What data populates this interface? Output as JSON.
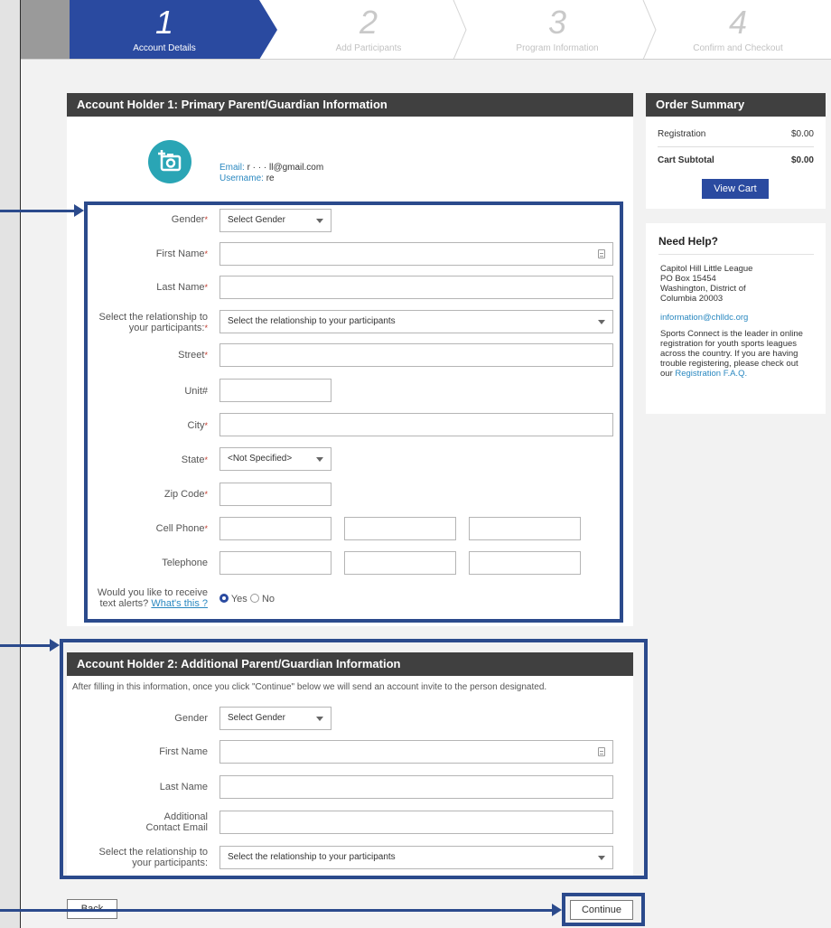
{
  "steps": [
    {
      "num": "1",
      "label": "Account Details"
    },
    {
      "num": "2",
      "label": "Add Participants"
    },
    {
      "num": "3",
      "label": "Program Information"
    },
    {
      "num": "4",
      "label": "Confirm and Checkout"
    }
  ],
  "holder1": {
    "title": "Account Holder 1: Primary Parent/Guardian Information",
    "email_label": "Email:",
    "email_value": "r       ·      ·  ·  ll@gmail.com",
    "username_label": "Username:",
    "username_value": "re",
    "fields": {
      "gender": {
        "label": "Gender",
        "value": "Select Gender"
      },
      "first_name": {
        "label": "First Name"
      },
      "last_name": {
        "label": "Last Name"
      },
      "relationship": {
        "label_line1": "Select the relationship to",
        "label_line2": "your participants:",
        "value": "Select the relationship to your participants"
      },
      "street": {
        "label": "Street"
      },
      "unit": {
        "label": "Unit#"
      },
      "city": {
        "label": "City"
      },
      "state": {
        "label": "State",
        "value": "<Not Specified>"
      },
      "zip": {
        "label": "Zip Code"
      },
      "cell": {
        "label": "Cell Phone"
      },
      "telephone": {
        "label": "Telephone"
      }
    },
    "text_alerts": {
      "label_line1": "Would you like to receive",
      "label_line2": "text alerts?",
      "link": "What's this ?",
      "yes": "Yes",
      "no": "No",
      "selected": "Yes"
    },
    "required_mark": "*"
  },
  "holder2": {
    "title": "Account Holder 2: Additional Parent/Guardian Information",
    "intro": "After filling in this information, once you click \"Continue\" below we will send an account invite to the person designated.",
    "fields": {
      "gender": {
        "label": "Gender",
        "value": "Select Gender"
      },
      "first_name": {
        "label": "First Name"
      },
      "last_name": {
        "label": "Last Name"
      },
      "email": {
        "label_line1": "Additional",
        "label_line2": "Contact Email"
      },
      "relationship": {
        "label_line1": "Select the relationship to",
        "label_line2": "your participants:",
        "value": "Select the relationship to your participants"
      }
    }
  },
  "order_summary": {
    "title": "Order Summary",
    "registration_label": "Registration",
    "registration_value": "$0.00",
    "subtotal_label": "Cart Subtotal",
    "subtotal_value": "$0.00",
    "view_cart": "View Cart"
  },
  "help": {
    "title": "Need Help?",
    "org": "Capitol Hill Little League",
    "box": "PO Box 15454",
    "city": "Washington, District of",
    "city2": "Columbia 20003",
    "email": "information@chlldc.org",
    "blurb_1": "Sports Connect is the leader in online",
    "blurb_2": "registration for youth sports leagues",
    "blurb_3": "across the country. If you are having",
    "blurb_4": "trouble registering, please check out",
    "blurb_5": "our ",
    "faq_link": "Registration F.A.Q."
  },
  "buttons": {
    "back": "Back",
    "continue": "Continue"
  },
  "colors": {
    "accent": "#2a4aa0",
    "highlight": "#2b4a8c",
    "header": "#404040",
    "teal": "#2aa5b5"
  }
}
